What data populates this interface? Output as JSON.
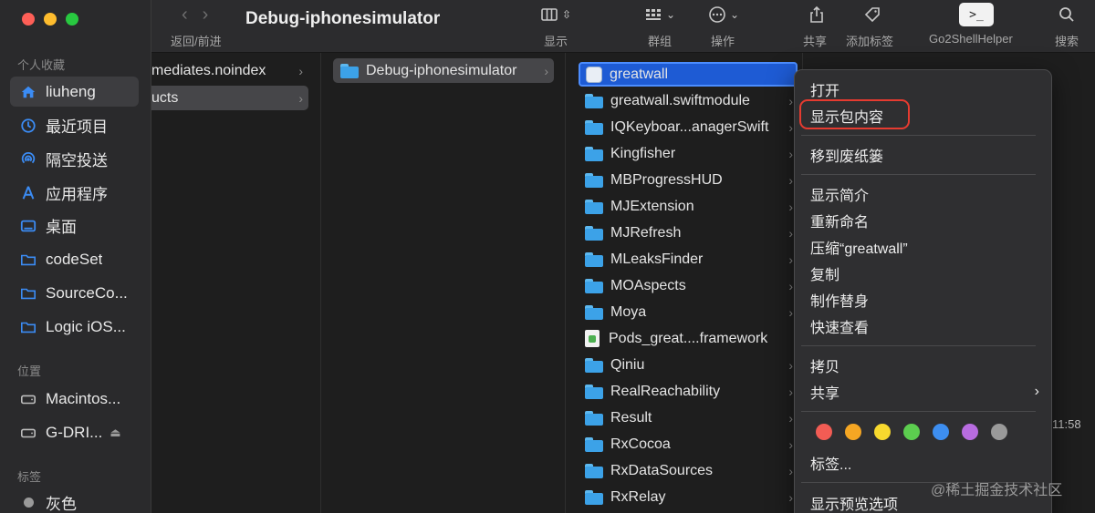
{
  "window": {
    "title": "Debug-iphonesimulator",
    "traffic_colors": [
      "#fe5f57",
      "#febc2e",
      "#28c840"
    ]
  },
  "toolbar": {
    "back_forward_label": "返回/前进",
    "view_label": "显示",
    "group_label": "群组",
    "action_label": "操作",
    "share_label": "共享",
    "tag_label": "添加标签",
    "go2shell_label": "Go2ShellHelper",
    "search_label": "搜索",
    "go2shell_glyph": ">_"
  },
  "sidebar": {
    "favorites_header": "个人收藏",
    "favorites": [
      {
        "label": "liuheng",
        "icon": "home-icon"
      },
      {
        "label": "最近项目",
        "icon": "clock-icon"
      },
      {
        "label": "隔空投送",
        "icon": "airdrop-icon"
      },
      {
        "label": "应用程序",
        "icon": "applications-icon"
      },
      {
        "label": "桌面",
        "icon": "desktop-icon"
      },
      {
        "label": "codeSet",
        "icon": "folder-icon"
      },
      {
        "label": "SourceCo...",
        "icon": "folder-icon"
      },
      {
        "label": "Logic iOS...",
        "icon": "folder-icon"
      }
    ],
    "locations_header": "位置",
    "locations": [
      {
        "label": "Macintos...",
        "icon": "disk-icon"
      },
      {
        "label": "G-DRI...",
        "icon": "disk-icon"
      }
    ],
    "tags_header": "标签",
    "tags": [
      {
        "label": "灰色",
        "color": "#9a9a9a"
      }
    ]
  },
  "columns": {
    "col1": [
      "mediates.noindex",
      "ucts"
    ],
    "col2": [
      "Debug-iphonesimulator"
    ],
    "col3": [
      {
        "label": "greatwall",
        "kind": "app"
      },
      {
        "label": "greatwall.swiftmodule",
        "kind": "folder"
      },
      {
        "label": "IQKeyboar...anagerSwift",
        "kind": "folder"
      },
      {
        "label": "Kingfisher",
        "kind": "folder"
      },
      {
        "label": "MBProgressHUD",
        "kind": "folder"
      },
      {
        "label": "MJExtension",
        "kind": "folder"
      },
      {
        "label": "MJRefresh",
        "kind": "folder"
      },
      {
        "label": "MLeaksFinder",
        "kind": "folder"
      },
      {
        "label": "MOAspects",
        "kind": "folder"
      },
      {
        "label": "Moya",
        "kind": "folder"
      },
      {
        "label": "Pods_great....framework",
        "kind": "file"
      },
      {
        "label": "Qiniu",
        "kind": "folder"
      },
      {
        "label": "RealReachability",
        "kind": "folder"
      },
      {
        "label": "Result",
        "kind": "folder"
      },
      {
        "label": "RxCocoa",
        "kind": "folder"
      },
      {
        "label": "RxDataSources",
        "kind": "folder"
      },
      {
        "label": "RxRelay",
        "kind": "folder"
      }
    ],
    "col4_time": "11:58"
  },
  "context_menu": {
    "items": [
      "打开",
      "显示包内容",
      "移到废纸篓",
      "显示简介",
      "重新命名",
      "压缩“greatwall”",
      "复制",
      "制作替身",
      "快速查看",
      "拷贝",
      "共享",
      "标签...",
      "显示预览选项"
    ],
    "tag_colors": [
      "#f25c54",
      "#f5a623",
      "#f8d92e",
      "#5ccd4f",
      "#3d8ef0",
      "#b86ce0",
      "#9a9a9a"
    ]
  },
  "watermark": "@稀土掘金技术社区"
}
